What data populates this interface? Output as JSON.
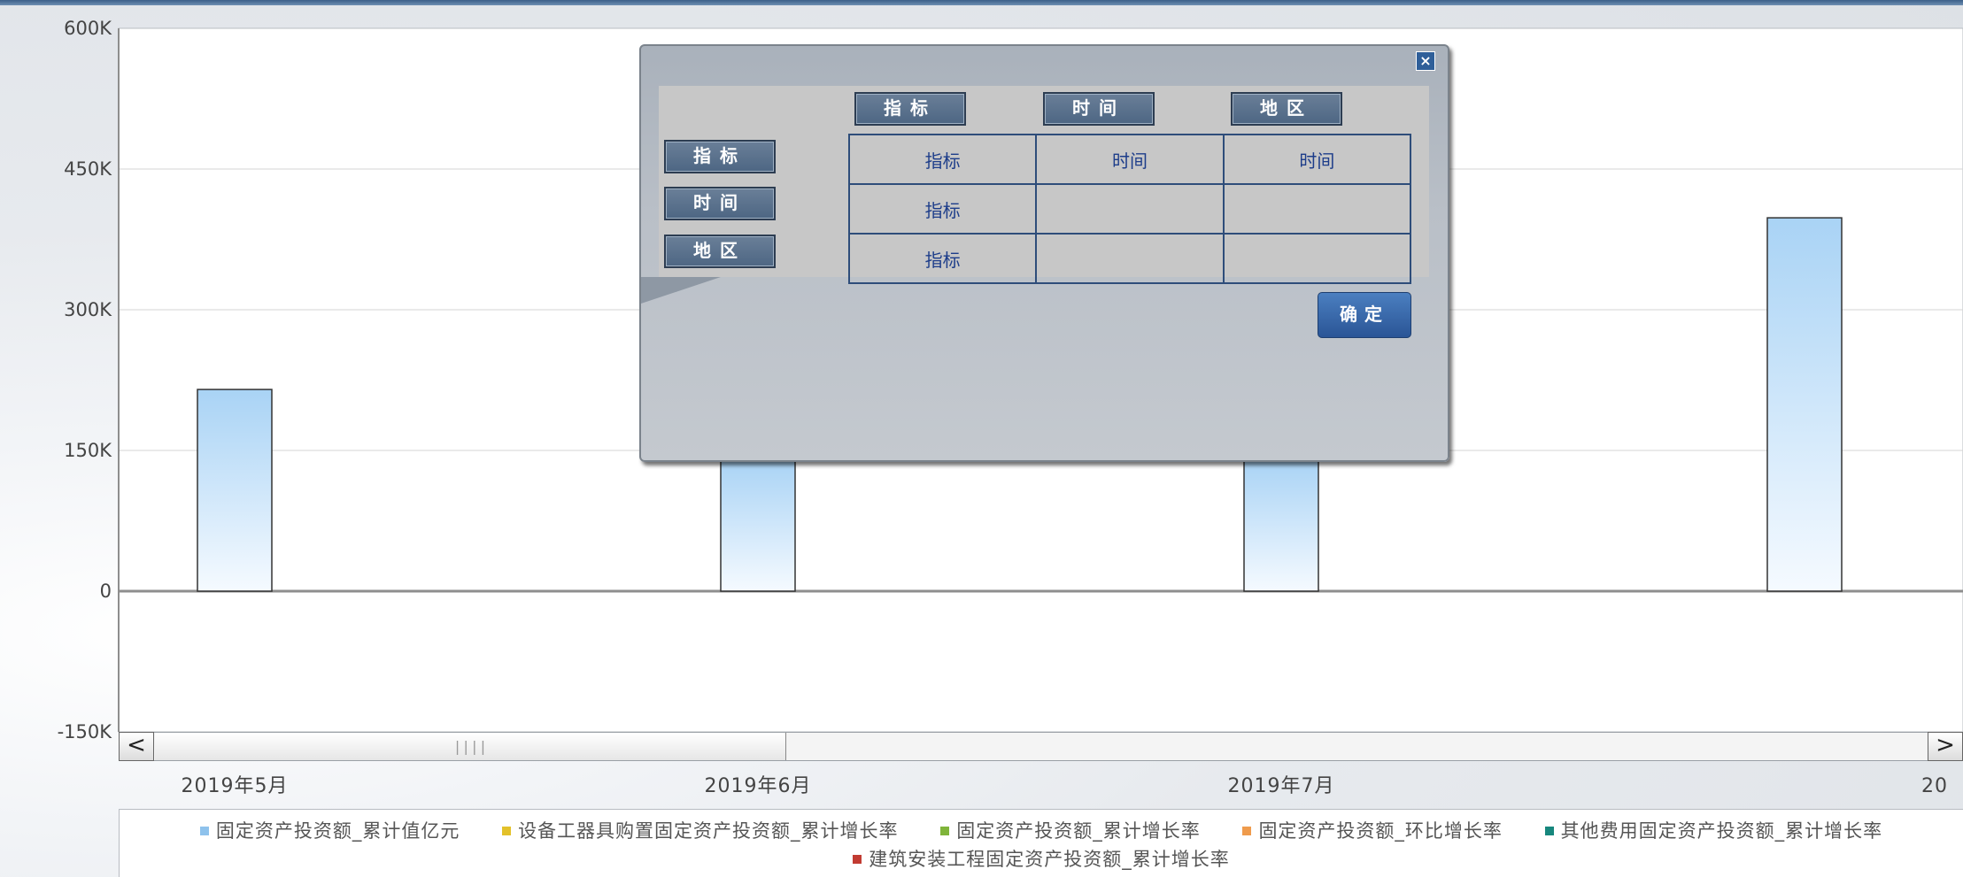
{
  "chart_data": {
    "type": "bar",
    "categories": [
      "2019年5月",
      "2019年6月",
      "2019年7月",
      "20"
    ],
    "series": [
      {
        "name": "固定资产投资额_累计值亿元",
        "values": [
          215000,
          140000,
          140000,
          398000
        ]
      }
    ],
    "ylim": [
      -150000,
      600000
    ],
    "yticks": [
      {
        "value": 600000,
        "label": "600K"
      },
      {
        "value": 450000,
        "label": "450K"
      },
      {
        "value": 300000,
        "label": "300K"
      },
      {
        "value": 150000,
        "label": "150K"
      },
      {
        "value": 0,
        "label": "0"
      },
      {
        "value": -150000,
        "label": "-150K"
      }
    ],
    "grid": true,
    "legend_position": "bottom",
    "bar_color_top": "#a9d3f5",
    "bar_color_bottom": "#f5faff"
  },
  "legend": {
    "items": [
      {
        "label": "固定资产投资额_累计值亿元",
        "color": "#8ec2ec"
      },
      {
        "label": "设备工器具购置固定资产投资额_累计增长率",
        "color": "#e3c12a"
      },
      {
        "label": "固定资产投资额_累计增长率",
        "color": "#7fb43a"
      },
      {
        "label": "固定资产投资额_环比增长率",
        "color": "#ef9b4c"
      },
      {
        "label": "其他费用固定资产投资额_累计增长率",
        "color": "#17877d"
      },
      {
        "label": "建筑安装工程固定资产投资额_累计增长率",
        "color": "#c23b32"
      }
    ]
  },
  "scrollbar": {
    "left_arrow": "<",
    "right_arrow": ">",
    "grip": "||||"
  },
  "dialog": {
    "close": "×",
    "col_headers": [
      "指标",
      "时间",
      "地区"
    ],
    "row_headers": [
      "指标",
      "时间",
      "地区"
    ],
    "cells": [
      [
        "指标",
        "时间",
        "时间"
      ],
      [
        "指标",
        "",
        ""
      ],
      [
        "指标",
        "",
        ""
      ]
    ],
    "ok": "确定"
  }
}
